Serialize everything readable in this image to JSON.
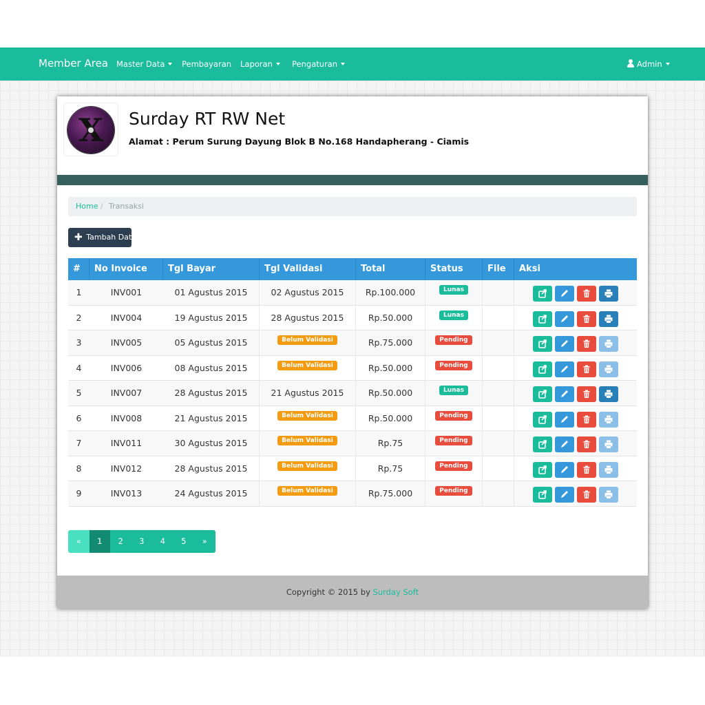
{
  "navbar": {
    "brand": "Member Area",
    "items": [
      {
        "label": "Master Data",
        "dropdown": true
      },
      {
        "label": "Pembayaran",
        "dropdown": false
      },
      {
        "label": "Laporan",
        "dropdown": true
      },
      {
        "label": "Pengaturan",
        "dropdown": true
      }
    ],
    "user": "Admin"
  },
  "header": {
    "logo_icon": "mac-os-x-disc-logo",
    "title": "Surday RT RW Net",
    "address": "Alamat : Perum Surung Dayung Blok B No.168 Handapherang - Ciamis"
  },
  "breadcrumb": {
    "home": "Home",
    "separator": "/",
    "current": "Transaksi"
  },
  "add_button": {
    "icon": "plus-icon",
    "label": "Tambah Data"
  },
  "table": {
    "headers": [
      "#",
      "No Invoice",
      "Tgl Bayar",
      "Tgl Validasi",
      "Total",
      "Status",
      "File",
      "Aksi"
    ],
    "rows": [
      {
        "no": "1",
        "invoice": "INV001",
        "tgl_bayar": "01 Agustus 2015",
        "tgl_validasi": "02 Agustus 2015",
        "total": "Rp.100.000",
        "status": "Lunas",
        "file": "",
        "print_enabled": true
      },
      {
        "no": "2",
        "invoice": "INV004",
        "tgl_bayar": "19 Agustus 2015",
        "tgl_validasi": "28 Agustus 2015",
        "total": "Rp.50.000",
        "status": "Lunas",
        "file": "",
        "print_enabled": true
      },
      {
        "no": "3",
        "invoice": "INV005",
        "tgl_bayar": "05 Agustus 2015",
        "tgl_validasi": "Belum Validasi",
        "total": "Rp.75.000",
        "status": "Pending",
        "file": "",
        "print_enabled": false
      },
      {
        "no": "4",
        "invoice": "INV006",
        "tgl_bayar": "08 Agustus 2015",
        "tgl_validasi": "Belum Validasi",
        "total": "Rp.50.000",
        "status": "Pending",
        "file": "",
        "print_enabled": false
      },
      {
        "no": "5",
        "invoice": "INV007",
        "tgl_bayar": "28 Agustus 2015",
        "tgl_validasi": "21 Agustus 2015",
        "total": "Rp.50.000",
        "status": "Lunas",
        "file": "",
        "print_enabled": true
      },
      {
        "no": "6",
        "invoice": "INV008",
        "tgl_bayar": "21 Agustus 2015",
        "tgl_validasi": "Belum Validasi",
        "total": "Rp.50.000",
        "status": "Pending",
        "file": "",
        "print_enabled": false
      },
      {
        "no": "7",
        "invoice": "INV011",
        "tgl_bayar": "30 Agustus 2015",
        "tgl_validasi": "Belum Validasi",
        "total": "Rp.75",
        "status": "Pending",
        "file": "",
        "print_enabled": false
      },
      {
        "no": "8",
        "invoice": "INV012",
        "tgl_bayar": "28 Agustus 2015",
        "tgl_validasi": "Belum Validasi",
        "total": "Rp.75",
        "status": "Pending",
        "file": "",
        "print_enabled": false
      },
      {
        "no": "9",
        "invoice": "INV013",
        "tgl_bayar": "24 Agustus 2015",
        "tgl_validasi": "Belum Validasi",
        "total": "Rp.75.000",
        "status": "Pending",
        "file": "",
        "print_enabled": false
      }
    ],
    "action_icons": [
      "open-external-icon",
      "pencil-icon",
      "trash-icon",
      "printer-icon"
    ]
  },
  "pagination": {
    "prev": "«",
    "pages": [
      "1",
      "2",
      "3",
      "4",
      "5"
    ],
    "active": "1",
    "next": "»"
  },
  "footer": {
    "text": "Copyright © 2015 by",
    "link": "Surday Soft"
  },
  "colors": {
    "primary": "#1abc9c",
    "table_header": "#3498db",
    "danger": "#e74c3c",
    "warning": "#f39c12",
    "dark": "#2c3e50",
    "header_bar": "#365f5c",
    "footer_bg": "#bdbdbd"
  }
}
